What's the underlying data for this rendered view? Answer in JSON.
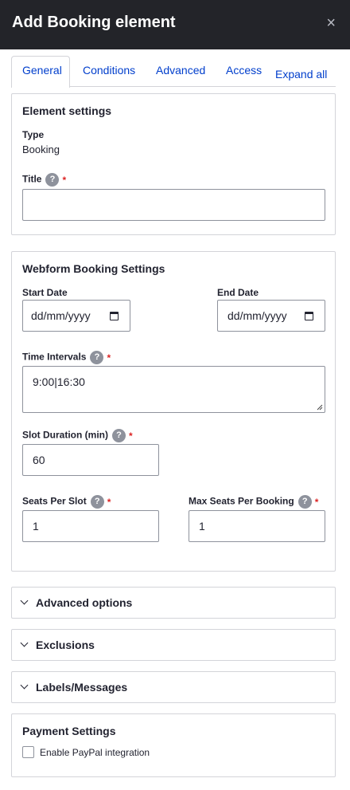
{
  "dialog": {
    "title": "Add Booking element",
    "close_label": "×"
  },
  "tabs": [
    {
      "label": "General",
      "active": true
    },
    {
      "label": "Conditions",
      "active": false
    },
    {
      "label": "Advanced",
      "active": false
    },
    {
      "label": "Access",
      "active": false
    }
  ],
  "expand_all": "Expand all",
  "element_settings": {
    "title": "Element settings",
    "type_label": "Type",
    "type_value": "Booking",
    "title_label": "Title",
    "title_value": ""
  },
  "booking_settings": {
    "title": "Webform Booking Settings",
    "start_date_label": "Start Date",
    "start_date_value": "dd/mm/yyyy",
    "end_date_label": "End Date",
    "end_date_value": "dd/mm/yyyy",
    "time_intervals_label": "Time Intervals",
    "time_intervals_value": "9:00|16:30",
    "slot_duration_label": "Slot Duration (min)",
    "slot_duration_value": "60",
    "seats_per_slot_label": "Seats Per Slot",
    "seats_per_slot_value": "1",
    "max_seats_label": "Max Seats Per Booking",
    "max_seats_value": "1"
  },
  "collapsibles": [
    {
      "label": "Advanced options"
    },
    {
      "label": "Exclusions"
    },
    {
      "label": "Labels/Messages"
    }
  ],
  "payment": {
    "title": "Payment Settings",
    "paypal_label": "Enable PayPal integration",
    "paypal_checked": false
  },
  "help_glyph": "?",
  "required_glyph": "*",
  "colors": {
    "header_bg": "#232429",
    "link": "#003ecc",
    "required": "#dc2323",
    "border": "#d3d4d9"
  }
}
